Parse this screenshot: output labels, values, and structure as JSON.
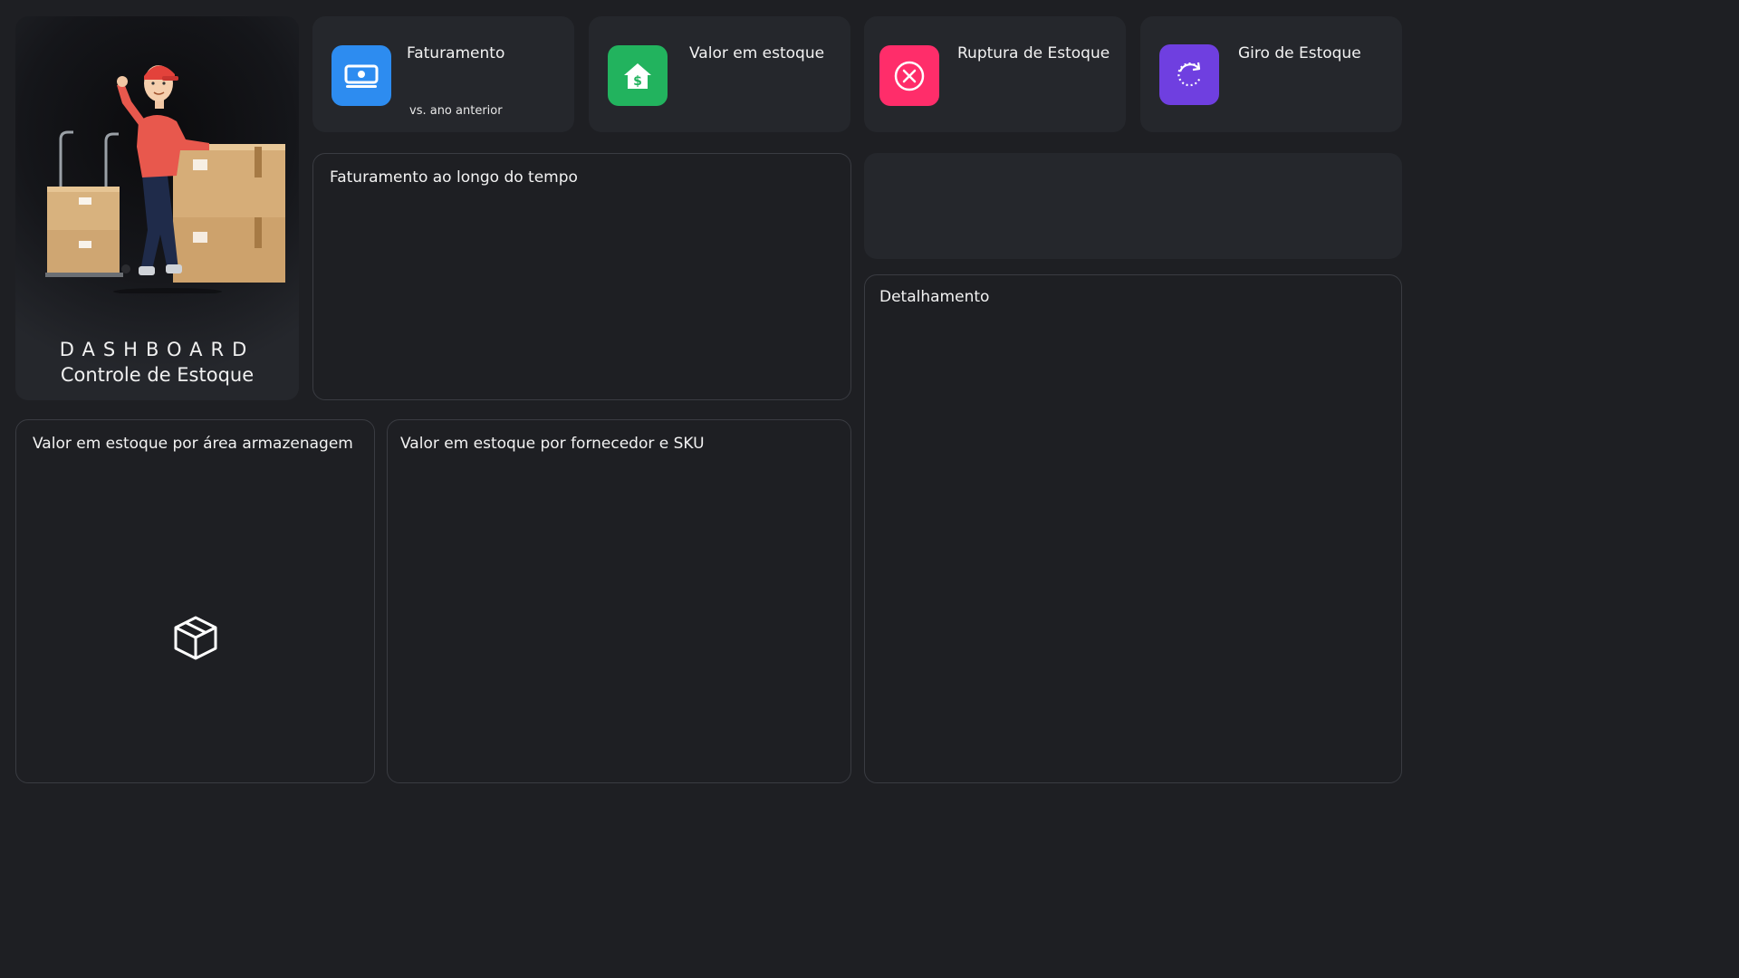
{
  "hero": {
    "title": "DASHBOARD",
    "subtitle": "Controle de Estoque"
  },
  "kpis": [
    {
      "label": "Faturamento",
      "sub": "vs. ano anterior",
      "icon": "money-icon",
      "color": "#2d8cf0"
    },
    {
      "label": "Valor em estoque",
      "icon": "house-dollar-icon",
      "color": "#22b35e"
    },
    {
      "label": "Ruptura de Estoque",
      "icon": "close-circle-icon",
      "color": "#ff2d6a"
    },
    {
      "label": "Giro de Estoque",
      "icon": "refresh-icon",
      "color": "#6f3fe0"
    }
  ],
  "panels": {
    "revenue_over_time": "Faturamento ao longo do tempo",
    "detail": "Detalhamento",
    "stock_by_area": "Valor em estoque por área armazenagem",
    "stock_by_supplier": "Valor em estoque por fornecedor e SKU"
  },
  "colors": {
    "background": "#1e1f23",
    "card": "#25272c",
    "border": "#3a3c42"
  }
}
